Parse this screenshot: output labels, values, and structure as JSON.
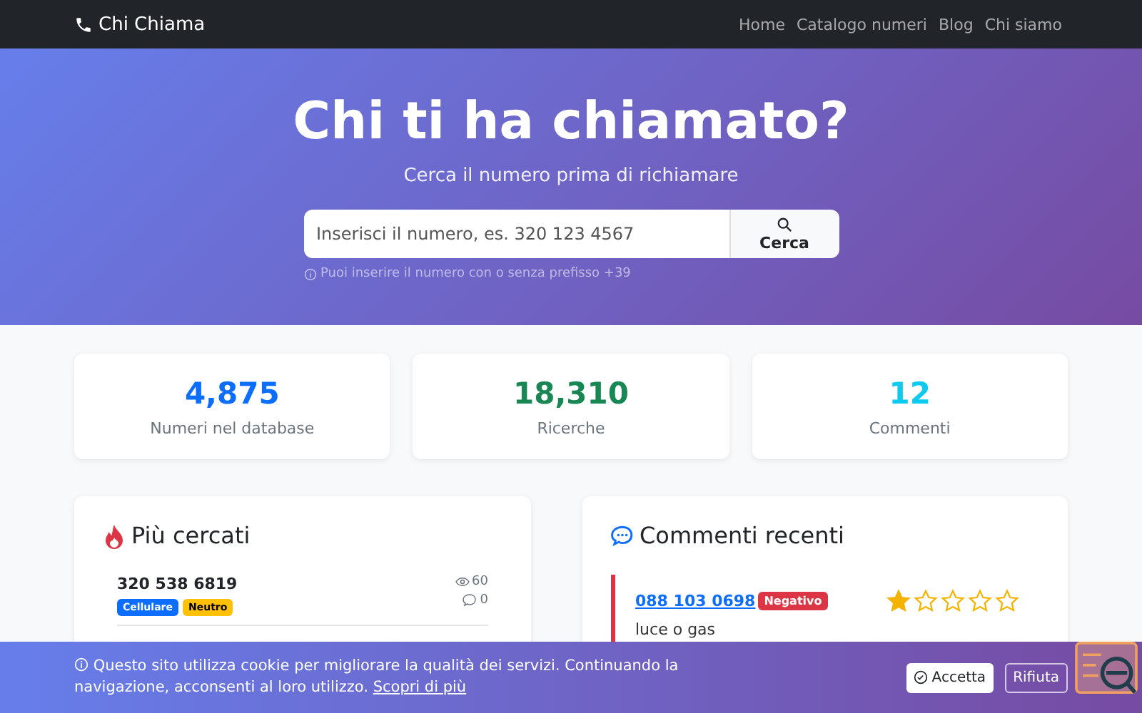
{
  "navbar": {
    "brand": "Chi Chiama",
    "links": [
      "Home",
      "Catalogo numeri",
      "Blog",
      "Chi siamo"
    ]
  },
  "hero": {
    "title": "Chi ti ha chiamato?",
    "subtitle": "Cerca il numero prima di richiamare",
    "search": {
      "placeholder": "Inserisci il numero, es. 320 123 4567",
      "button": "Cerca"
    },
    "hint": "Puoi inserire il numero con o senza prefisso +39"
  },
  "stats": [
    {
      "value": "4,875",
      "label": "Numeri nel database",
      "color": "#0d6efd"
    },
    {
      "value": "18,310",
      "label": "Ricerche",
      "color": "#198754"
    },
    {
      "value": "12",
      "label": "Commenti",
      "color": "#0dcaf0"
    }
  ],
  "most_searched": {
    "title": "Più cercati",
    "items": [
      {
        "number": "320 538 6819",
        "views": "60",
        "comments": "0",
        "badges": [
          {
            "label": "Cellulare",
            "color": "#0d6efd"
          },
          {
            "label": "Neutro",
            "color": "#ffc107"
          }
        ]
      }
    ]
  },
  "recent_comments": {
    "title": "Commenti recenti",
    "items": [
      {
        "number": "088 103 0698",
        "badge": {
          "label": "Negativo",
          "color": "#dc3545"
        },
        "stars": 1,
        "text": "luce o gas"
      }
    ]
  },
  "cookie_banner": {
    "text": "Questo sito utilizza cookie per migliorare la qualità dei servizi. Continuando la navigazione, acconsenti al loro utilizzo.",
    "link": "Scopri di più",
    "accept": "Accetta",
    "reject": "Rifiuta"
  }
}
